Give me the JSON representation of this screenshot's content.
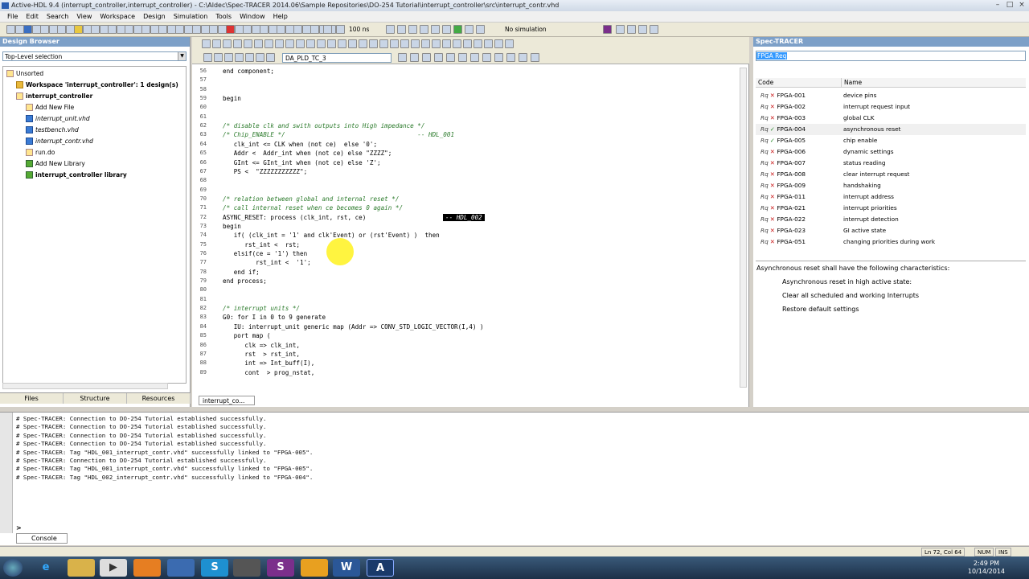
{
  "window": {
    "title": "Active-HDL 9.4 (interrupt_controller,interrupt_controller) - C:\\Aldec\\Spec-TRACER 2014.06\\Sample Repositories\\DO-254 Tutorial\\interrupt_controller\\src\\interrupt_contr.vhd"
  },
  "menu": [
    "File",
    "Edit",
    "Search",
    "View",
    "Workspace",
    "Design",
    "Simulation",
    "Tools",
    "Window",
    "Help"
  ],
  "toolbar": {
    "sim_time": "100 ns",
    "sim_status": "No simulation"
  },
  "design_browser": {
    "title": "Design Browser",
    "top_level": "Top-Level selection",
    "tree": [
      {
        "label": "Unsorted",
        "indent": 0,
        "style": "normal",
        "icon": "unsorted-icon"
      },
      {
        "label": "Workspace 'interrupt_controller': 1 design(s)",
        "indent": 1,
        "style": "bold",
        "icon": "workspace-icon"
      },
      {
        "label": "interrupt_controller",
        "indent": 1,
        "style": "bold",
        "icon": "design-icon"
      },
      {
        "label": "Add New File",
        "indent": 2,
        "style": "normal",
        "icon": "add-file-icon"
      },
      {
        "label": "interrupt_unit.vhd",
        "indent": 2,
        "style": "italic",
        "icon": "vhdl-file-icon"
      },
      {
        "label": "testbench.vhd",
        "indent": 2,
        "style": "italic",
        "icon": "vhdl-file-icon"
      },
      {
        "label": "interrupt_contr.vhd",
        "indent": 2,
        "style": "italic",
        "icon": "vhdl-file-icon"
      },
      {
        "label": "run.do",
        "indent": 2,
        "style": "normal",
        "icon": "macro-file-icon"
      },
      {
        "label": "Add New Library",
        "indent": 2,
        "style": "normal",
        "icon": "add-library-icon"
      },
      {
        "label": "interrupt_controller library",
        "indent": 2,
        "style": "bold",
        "icon": "library-icon"
      }
    ],
    "tabs": [
      "Files",
      "Structure",
      "Resources"
    ]
  },
  "editor": {
    "combo": "DA_PLD_TC_3",
    "tab": "interrupt_co...",
    "lines": [
      {
        "n": "56",
        "text": "end component;",
        "cls": ""
      },
      {
        "n": "57",
        "text": "",
        "cls": ""
      },
      {
        "n": "58",
        "text": "",
        "cls": ""
      },
      {
        "n": "59",
        "text": "begin",
        "cls": ""
      },
      {
        "n": "60",
        "text": "",
        "cls": ""
      },
      {
        "n": "61",
        "text": "",
        "cls": ""
      },
      {
        "n": "62",
        "text": "/* disable clk and swith outputs into High impedance */",
        "cls": "cm"
      },
      {
        "n": "63",
        "text": "/* Chip_ENABLE */                                    -- HDL_001",
        "cls": "cm"
      },
      {
        "n": "64",
        "text": "   clk_int <= CLK when (not ce)  else '0';",
        "cls": ""
      },
      {
        "n": "65",
        "text": "   Addr <  Addr_int when (not ce) else \"ZZZZ\";",
        "cls": ""
      },
      {
        "n": "66",
        "text": "   GInt <= GInt_int when (not ce) else 'Z';",
        "cls": ""
      },
      {
        "n": "67",
        "text": "   PS <  \"ZZZZZZZZZZZ\";",
        "cls": ""
      },
      {
        "n": "68",
        "text": "",
        "cls": ""
      },
      {
        "n": "69",
        "text": "",
        "cls": ""
      },
      {
        "n": "70",
        "text": "/* relation between global and internal reset */",
        "cls": "cm"
      },
      {
        "n": "71",
        "text": "/* call internal reset when ce becomes 0 again */",
        "cls": "cm"
      },
      {
        "n": "72",
        "text": "ASYNC_RESET: process (clk_int, rst, ce)",
        "cls": ""
      },
      {
        "n": "73",
        "text": "begin",
        "cls": ""
      },
      {
        "n": "74",
        "text": "   if( (clk_int = '1' and clk'Event) or (rst'Event) )  then",
        "cls": ""
      },
      {
        "n": "75",
        "text": "      rst_int <  rst;",
        "cls": ""
      },
      {
        "n": "76",
        "text": "   elsif(ce = '1') then",
        "cls": ""
      },
      {
        "n": "77",
        "text": "         rst_int <  '1';",
        "cls": ""
      },
      {
        "n": "78",
        "text": "   end if;",
        "cls": ""
      },
      {
        "n": "79",
        "text": "end process;",
        "cls": ""
      },
      {
        "n": "80",
        "text": "",
        "cls": ""
      },
      {
        "n": "81",
        "text": "",
        "cls": ""
      },
      {
        "n": "82",
        "text": "/* interrupt units */",
        "cls": "cm"
      },
      {
        "n": "83",
        "text": "G0: for I in 0 to 9 generate",
        "cls": ""
      },
      {
        "n": "84",
        "text": "   IU: interrupt_unit generic map (Addr => CONV_STD_LOGIC_VECTOR(I,4) )",
        "cls": ""
      },
      {
        "n": "85",
        "text": "   port map (",
        "cls": ""
      },
      {
        "n": "86",
        "text": "      clk => clk_int,",
        "cls": ""
      },
      {
        "n": "87",
        "text": "      rst  > rst_int,",
        "cls": ""
      },
      {
        "n": "88",
        "text": "      int => Int_buff(I),",
        "cls": ""
      },
      {
        "n": "89",
        "text": "      cont  > prog_nstat,",
        "cls": ""
      }
    ],
    "inline_tag": "-- HDL_002"
  },
  "spec_tracer": {
    "title": "Spec-TRACER",
    "search": "FPGA Req",
    "col_code": "Code",
    "col_name": "Name",
    "rows": [
      {
        "code": "FPGA-001",
        "name": "device pins",
        "status": "x"
      },
      {
        "code": "FPGA-002",
        "name": "interrupt request input",
        "status": "x"
      },
      {
        "code": "FPGA-003",
        "name": "global CLK",
        "status": "x"
      },
      {
        "code": "FPGA-004",
        "name": "asynchronous reset",
        "status": "check"
      },
      {
        "code": "FPGA-005",
        "name": "chip enable",
        "status": "check"
      },
      {
        "code": "FPGA-006",
        "name": "dynamic settings",
        "status": "x"
      },
      {
        "code": "FPGA-007",
        "name": "status reading",
        "status": "x"
      },
      {
        "code": "FPGA-008",
        "name": "clear interrupt request",
        "status": "x"
      },
      {
        "code": "FPGA-009",
        "name": "handshaking",
        "status": "x"
      },
      {
        "code": "FPGA-011",
        "name": "interrupt address",
        "status": "x"
      },
      {
        "code": "FPGA-021",
        "name": "interrupt priorities",
        "status": "x"
      },
      {
        "code": "FPGA-022",
        "name": "interrupt detection",
        "status": "x"
      },
      {
        "code": "FPGA-023",
        "name": "GI active state",
        "status": "x"
      },
      {
        "code": "FPGA-051",
        "name": "changing priorities during work",
        "status": "x"
      }
    ],
    "description": {
      "intro": "Asynchronous reset shall have the following characteristics:",
      "bullets": [
        "Asynchronous reset in high active state:",
        "Clear all scheduled and working Interrupts",
        "Restore default settings"
      ]
    }
  },
  "console": {
    "lines": [
      "# Spec-TRACER: Connection to DO-254 Tutorial established successfully.",
      "# Spec-TRACER: Connection to DO-254 Tutorial established successfully.",
      "# Spec-TRACER: Connection to DO-254 Tutorial established successfully.",
      "# Spec-TRACER: Connection to DO-254 Tutorial established successfully.",
      "# Spec-TRACER: Tag \"HDL_001_interrupt_contr.vhd\" successfully linked to \"FPGA-005\".",
      "# Spec-TRACER: Connection to DO-254 Tutorial established successfully.",
      "# Spec-TRACER: Tag \"HDL_001_interrupt_contr.vhd\" successfully linked to \"FPGA-005\".",
      "# Spec-TRACER: Tag \"HDL_002_interrupt_contr.vhd\" successfully linked to \"FPGA-004\"."
    ],
    "tab": "Console",
    "prompt": ">"
  },
  "status": {
    "position": "Ln 72, Col 64",
    "num": "NUM",
    "ins": "INS"
  },
  "taskbar": {
    "time": "2:49 PM",
    "date": "10/14/2014"
  }
}
